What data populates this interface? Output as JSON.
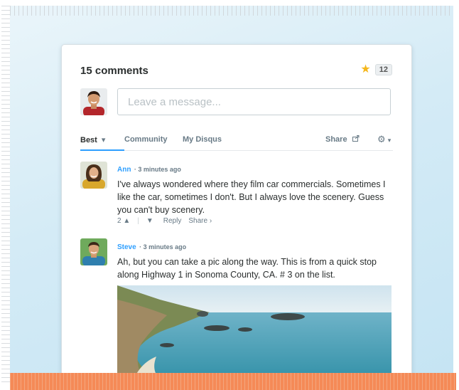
{
  "header": {
    "title": "15 comments",
    "star_count": "12"
  },
  "composer": {
    "placeholder": "Leave a message..."
  },
  "tabs": {
    "best": "Best",
    "community": "Community",
    "my_disqus": "My Disqus",
    "share": "Share"
  },
  "comments": [
    {
      "author": "Ann",
      "time": "3 minutes ago",
      "text": "I've always wondered where they film car commercials. Sometimes I like the car, sometimes I don't. But I always love the scenery. Guess you can't buy scenery.",
      "votes": "2",
      "reply": "Reply",
      "share": "Share"
    },
    {
      "author": "Steve",
      "time": "3 minutes ago",
      "text": "Ah, but you can take a pic along the way. This is from a quick stop along Highway 1 in Sonoma County, CA. # 3 on the list."
    }
  ],
  "colors": {
    "accent": "#2e9fff",
    "star": "#f5b71c",
    "orange": "#f58a57"
  }
}
